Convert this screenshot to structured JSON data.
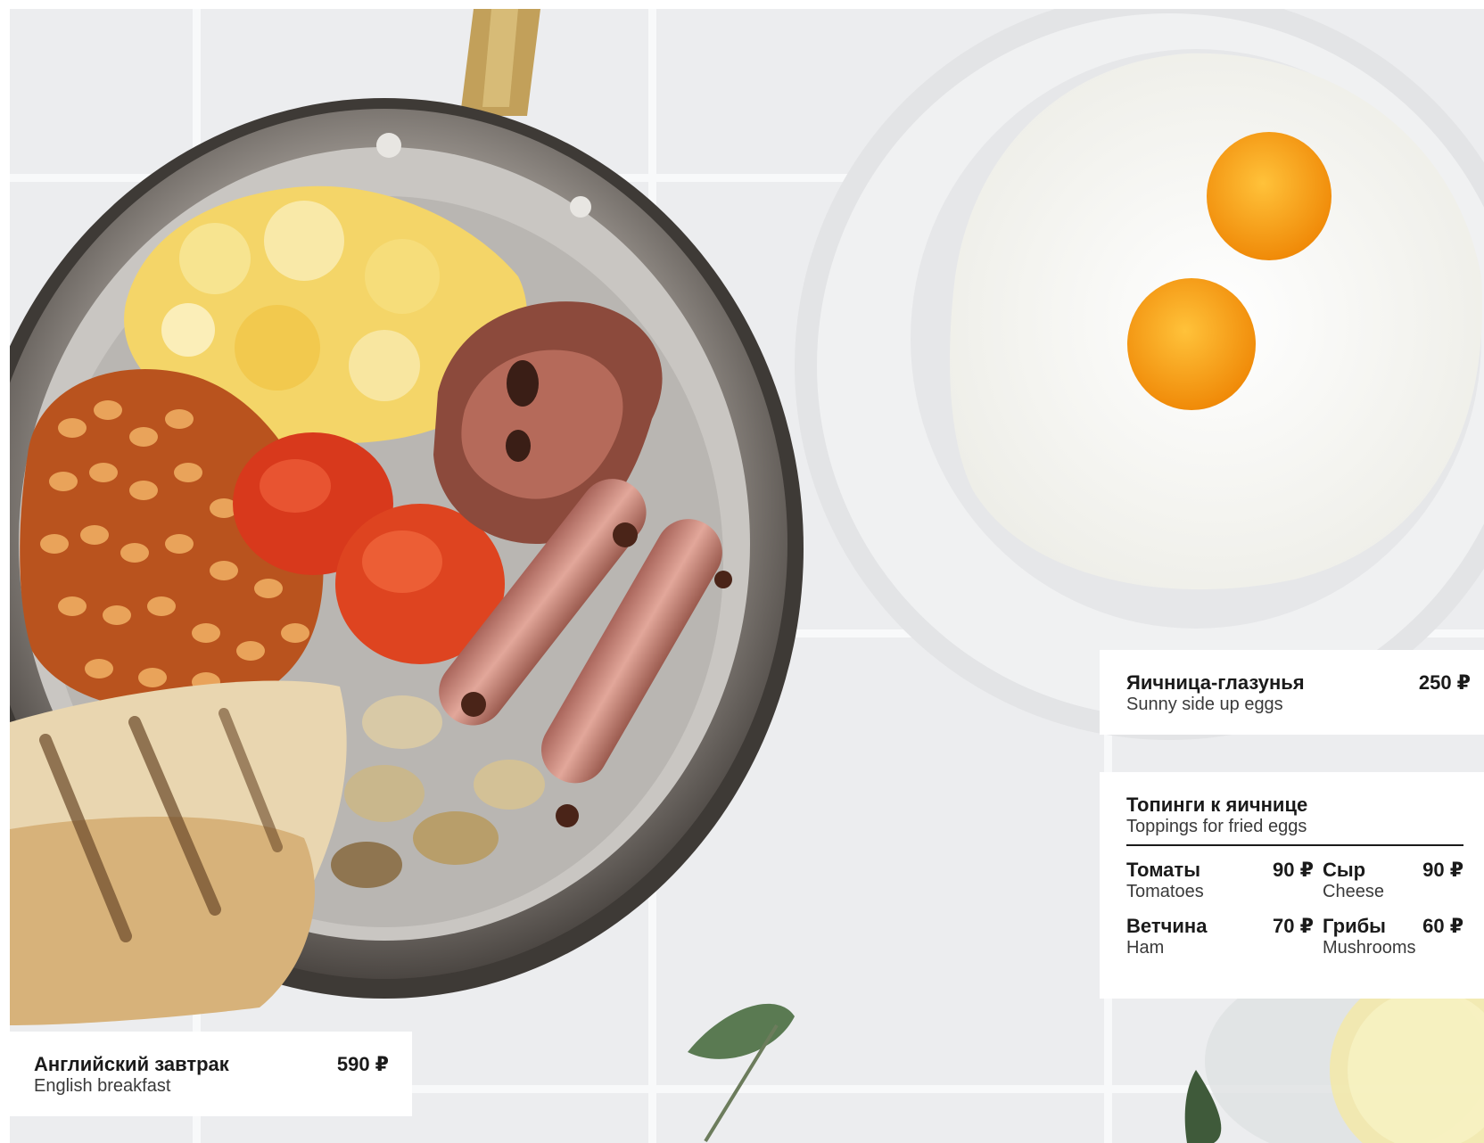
{
  "english_breakfast": {
    "title": "Английский завтрак",
    "subtitle": "English breakfast",
    "price": "590 ₽"
  },
  "fried_eggs": {
    "title": "Яичница-глазунья",
    "subtitle": "Sunny side up eggs",
    "price": "250 ₽"
  },
  "toppings": {
    "title": "Топинги к яичнице",
    "subtitle": "Toppings for fried eggs",
    "items": [
      {
        "name": "Томаты",
        "sub": "Tomatoes",
        "price": "90 ₽"
      },
      {
        "name": "Сыр",
        "sub": "Cheese",
        "price": "90 ₽"
      },
      {
        "name": "Ветчина",
        "sub": "Ham",
        "price": "70 ₽"
      },
      {
        "name": "Грибы",
        "sub": "Mushrooms",
        "price": "60 ₽"
      }
    ]
  },
  "colors": {
    "background": "#ecedef",
    "text": "#1a1a1a",
    "card": "#ffffff"
  }
}
